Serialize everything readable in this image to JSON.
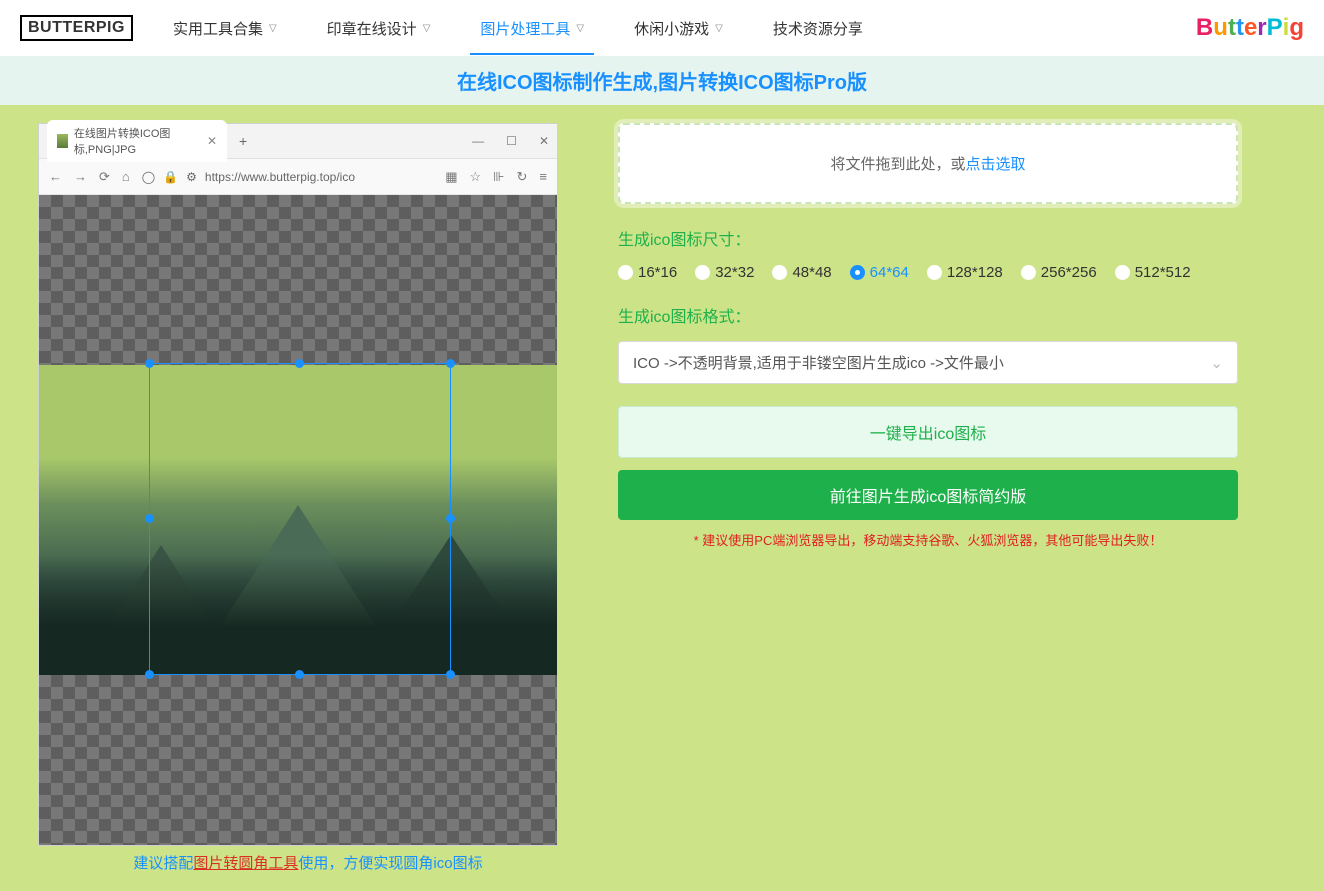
{
  "header": {
    "logo": "BUTTERPIG",
    "nav": [
      "实用工具合集",
      "印章在线设计",
      "图片处理工具",
      "休闲小游戏",
      "技术资源分享"
    ],
    "active": 2,
    "brand": "ButterPig"
  },
  "title": "在线ICO图标制作生成,图片转换ICO图标Pro版",
  "browser": {
    "tab_title": "在线图片转换ICO图标,PNG|JPG",
    "url": "https://www.butterpig.top/ico"
  },
  "hint": {
    "prefix": "建议搭配",
    "link": "图片转圆角工具",
    "suffix": "使用，方便实现圆角ico图标"
  },
  "drop": {
    "text": "将文件拖到此处，或",
    "link": "点击选取"
  },
  "size": {
    "label": "生成ico图标尺寸：",
    "options": [
      "16*16",
      "32*32",
      "48*48",
      "64*64",
      "128*128",
      "256*256",
      "512*512"
    ],
    "selected": "64*64"
  },
  "format": {
    "label": "生成ico图标格式：",
    "value": "ICO ->不透明背景,适用于非镂空图片生成ico ->文件最小"
  },
  "buttons": {
    "export": "一键导出ico图标",
    "simple": "前往图片生成ico图标简约版"
  },
  "warning": "* 建议使用PC端浏览器导出，移动端支持谷歌、火狐浏览器，其他可能导出失败！"
}
